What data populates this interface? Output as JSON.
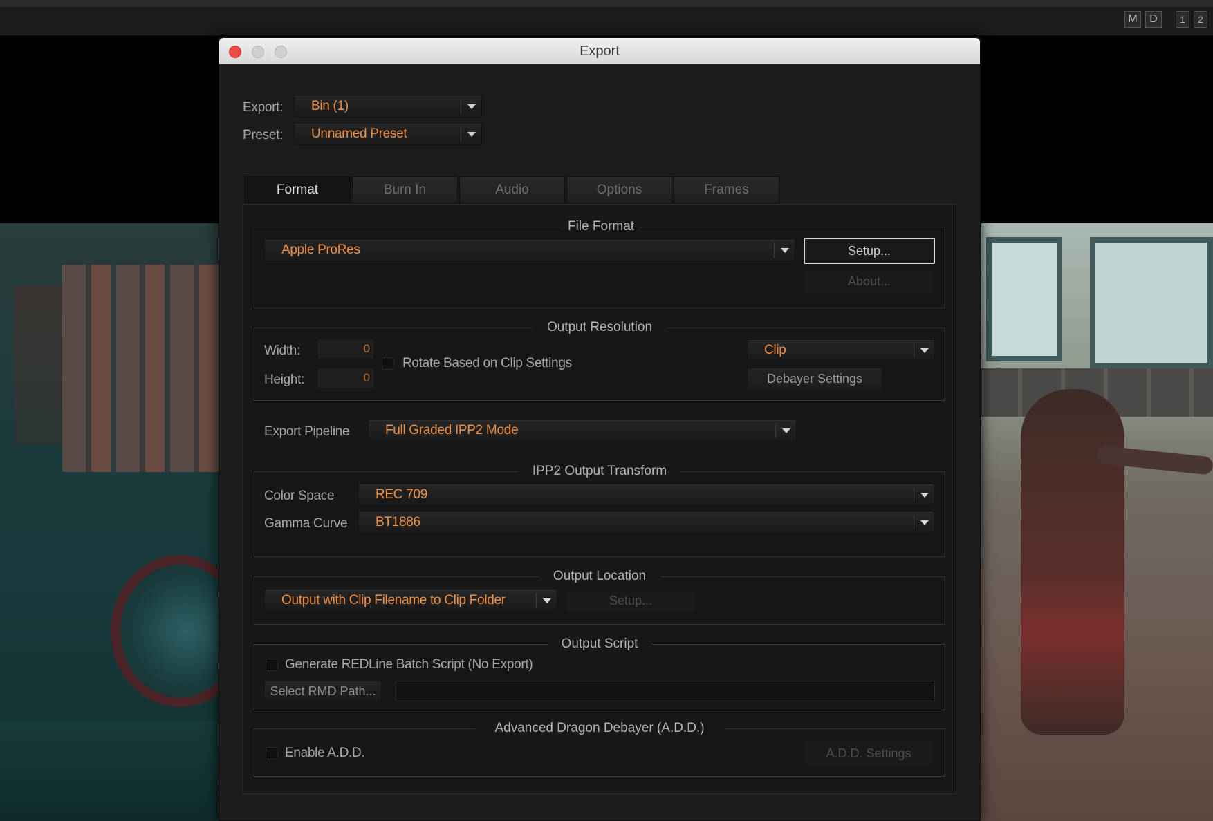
{
  "topbar": {
    "buttons": [
      "M",
      "D",
      "1",
      "2"
    ]
  },
  "dialog": {
    "title": "Export",
    "export": {
      "label": "Export:",
      "value": "Bin (1)"
    },
    "preset": {
      "label": "Preset:",
      "value": "Unnamed Preset"
    },
    "tabs": [
      {
        "label": "Format",
        "active": true
      },
      {
        "label": "Burn In"
      },
      {
        "label": "Audio"
      },
      {
        "label": "Options"
      },
      {
        "label": "Frames"
      }
    ],
    "file_format": {
      "title": "File Format",
      "value": "Apple ProRes",
      "setup_label": "Setup...",
      "about_label": "About..."
    },
    "output_resolution": {
      "title": "Output Resolution",
      "width_label": "Width:",
      "width_value": "0",
      "height_label": "Height:",
      "height_value": "0",
      "rotate_label": "Rotate Based on Clip Settings",
      "mode_value": "Clip",
      "debayer_label": "Debayer Settings"
    },
    "pipeline": {
      "label": "Export Pipeline",
      "value": "Full Graded IPP2 Mode"
    },
    "ipp2": {
      "title": "IPP2 Output Transform",
      "color_space_label": "Color Space",
      "color_space_value": "REC 709",
      "gamma_label": "Gamma Curve",
      "gamma_value": "BT1886"
    },
    "output_location": {
      "title": "Output Location",
      "value": "Output with Clip Filename to Clip Folder",
      "setup_label": "Setup..."
    },
    "output_script": {
      "title": "Output Script",
      "generate_label": "Generate REDLine Batch Script (No Export)",
      "select_rmd_label": "Select RMD Path..."
    },
    "add": {
      "title": "Advanced Dragon Debayer (A.D.D.)",
      "enable_label": "Enable A.D.D.",
      "settings_label": "A.D.D. Settings"
    }
  },
  "colors": {
    "accent": "#f09040",
    "close": "#ee4a44"
  }
}
